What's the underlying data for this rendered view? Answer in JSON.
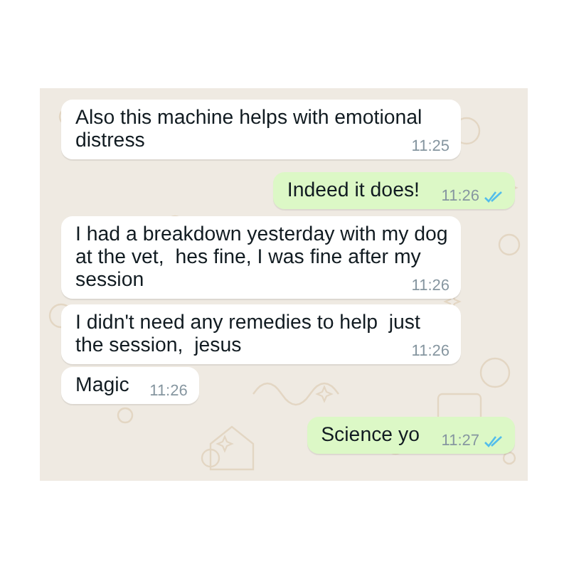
{
  "messages": [
    {
      "kind": "incoming",
      "text": "Also this machine helps with emotional distress",
      "time": "11:25"
    },
    {
      "kind": "outgoing",
      "text": "Indeed it does!",
      "time": "11:26",
      "read": true
    },
    {
      "kind": "incoming",
      "text": "I had a breakdown yesterday with my dog at the vet,  hes fine, I was fine after my session",
      "time": "11:26"
    },
    {
      "kind": "incoming",
      "text": "I didn't need any remedies to help  just the session,  jesus",
      "time": "11:26"
    },
    {
      "kind": "incoming",
      "text": "Magic",
      "time": "11:26"
    },
    {
      "kind": "outgoing",
      "text": "Science yo",
      "time": "11:27",
      "read": true
    }
  ]
}
